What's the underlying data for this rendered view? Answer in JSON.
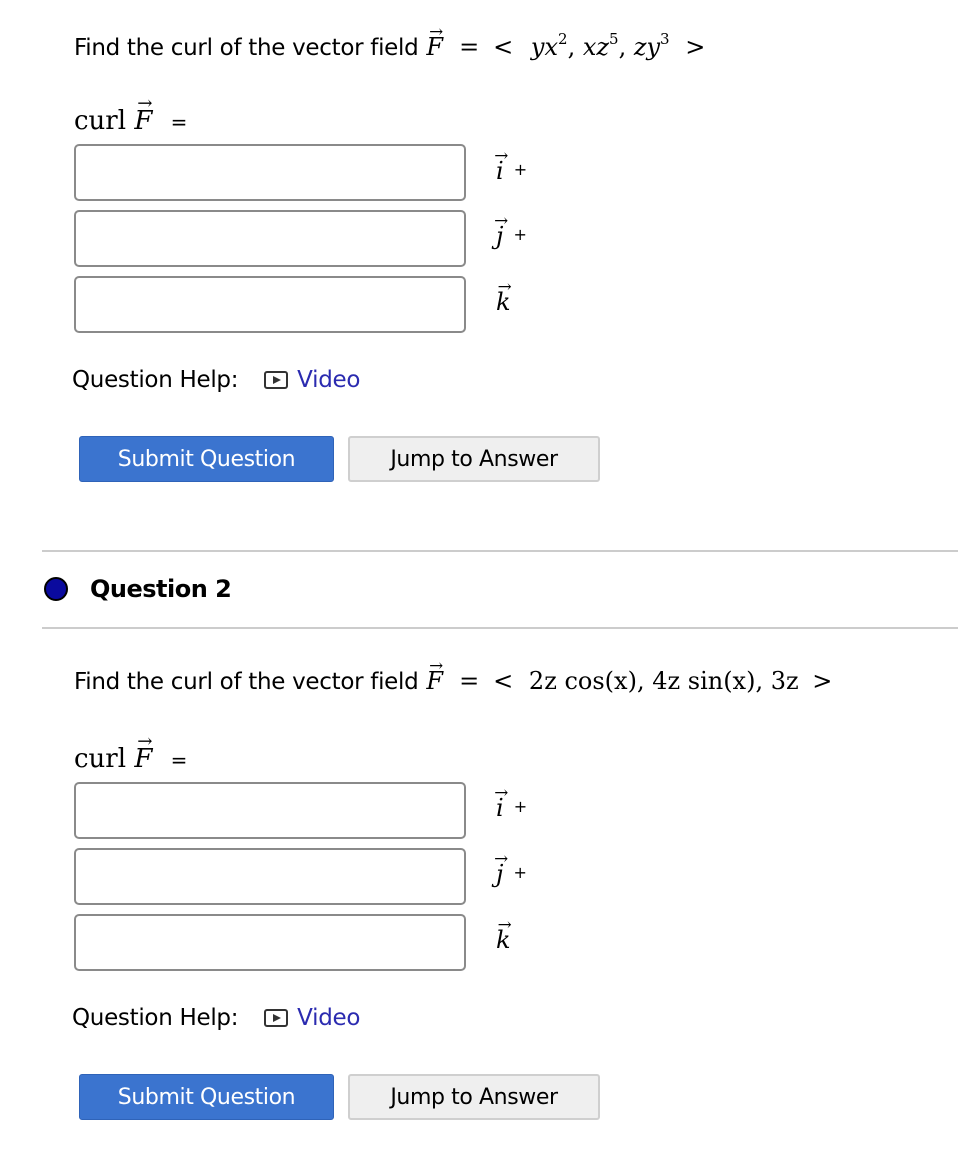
{
  "questions": [
    {
      "prompt": "Find the curl of the vector field",
      "field_symbol": "F",
      "equals": "=",
      "expression": {
        "open": "<",
        "components": [
          {
            "base": "yx",
            "exp": "2"
          },
          {
            "base": "xz",
            "exp": "5"
          },
          {
            "base": "zy",
            "exp": "3"
          }
        ],
        "close": ">"
      },
      "curl_label": "curl",
      "curl_equals": "=",
      "inputs": [
        {
          "value": "",
          "placeholder": "",
          "unit": "i",
          "suffix": "+"
        },
        {
          "value": "",
          "placeholder": "",
          "unit": "j",
          "suffix": "+"
        },
        {
          "value": "",
          "placeholder": "",
          "unit": "k",
          "suffix": ""
        }
      ],
      "help_label": "Question Help:",
      "help_link": "Video",
      "help_icon": "video-play-icon",
      "submit_label": "Submit Question",
      "jump_label": "Jump to Answer"
    },
    {
      "header": "Question 2",
      "status_color": "#0a0a9e",
      "prompt": "Find the curl of the vector field",
      "field_symbol": "F",
      "equals": "=",
      "expression_text": "< 2z cos(x), 4z sin(x), 3z >",
      "expression": {
        "open": "<",
        "components": [
          "2z cos(x)",
          "4z sin(x)",
          "3z"
        ],
        "close": ">"
      },
      "curl_label": "curl",
      "curl_equals": "=",
      "inputs": [
        {
          "value": "",
          "placeholder": "",
          "unit": "i",
          "suffix": "+"
        },
        {
          "value": "",
          "placeholder": "",
          "unit": "j",
          "suffix": "+"
        },
        {
          "value": "",
          "placeholder": "",
          "unit": "k",
          "suffix": ""
        }
      ],
      "help_label": "Question Help:",
      "help_link": "Video",
      "help_icon": "video-play-icon",
      "submit_label": "Submit Question",
      "jump_label": "Jump to Answer"
    }
  ],
  "colors": {
    "submit_bg": "#3b74cf",
    "link": "#2b2bb0",
    "divider": "#cccccc"
  }
}
